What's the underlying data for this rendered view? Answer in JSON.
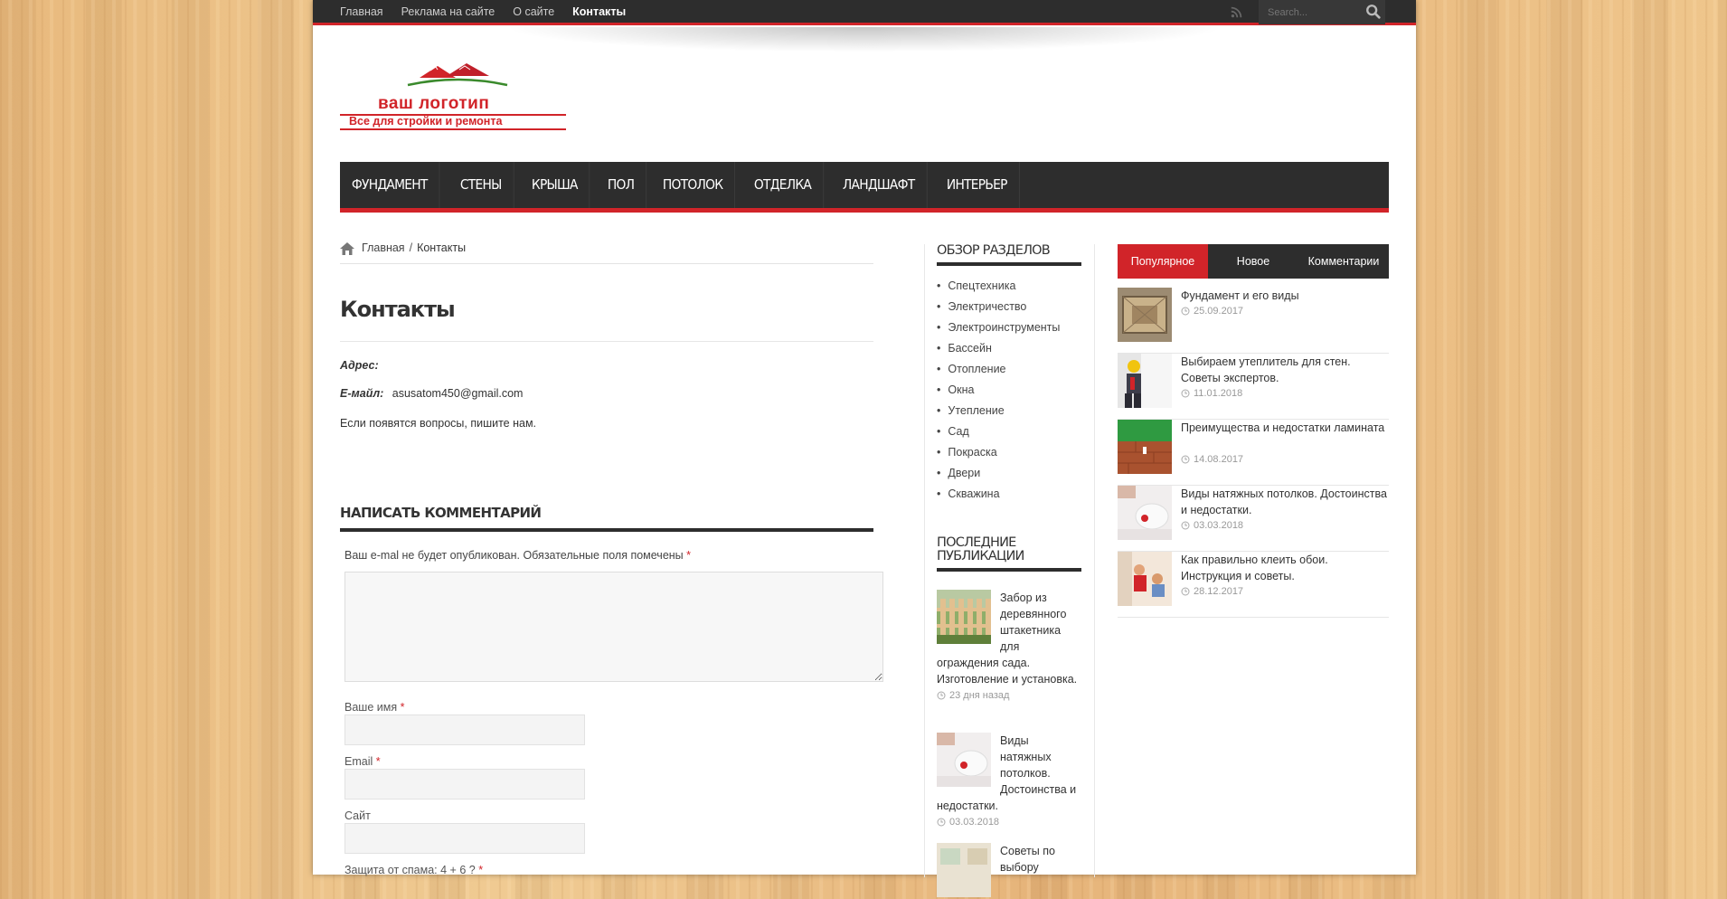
{
  "topbar": {
    "nav": [
      "Главная",
      "Реклама на сайте",
      "О сайте",
      "Контакты"
    ],
    "active_index": 3,
    "search_placeholder": "Search..."
  },
  "logo": {
    "title": "ваш логотип",
    "subtitle": "Все для стройки и ремонта"
  },
  "main_nav": [
    "ФУНДАМЕНТ",
    "СТЕНЫ",
    "КРЫША",
    "ПОЛ",
    "ПОТОЛОК",
    "ОТДЕЛКА",
    "ЛАНДШАФТ",
    "ИНТЕРЬЕР"
  ],
  "breadcrumb": {
    "home": "Главная",
    "separator": "/",
    "current": "Контакты"
  },
  "page": {
    "title": "Контакты",
    "address_label": "Адрес:",
    "email_label": "E-майл:",
    "email_value": "asusatom450@gmail.com",
    "note": "Если появятся вопросы, пишите нам."
  },
  "comment_form": {
    "title": "НАПИСАТЬ КОММЕНТАРИЙ",
    "note": "Ваш e-mal не будет опубликован. Обязательные поля помечены",
    "required_mark": "*",
    "name_label": "Ваше имя",
    "email_label": "Email",
    "site_label": "Сайт",
    "spam_label": "Защита от спама: 4 + 6 ?"
  },
  "sidebar": {
    "categories_title": "ОБЗОР РАЗДЕЛОВ",
    "categories": [
      "Спецтехника",
      "Электричество",
      "Электроинструменты",
      "Бассейн",
      "Отопление",
      "Окна",
      "Утепление",
      "Сад",
      "Покраска",
      "Двери",
      "Скважина"
    ],
    "recent_title_line1": "ПОСЛЕДНИЕ",
    "recent_title_line2": "ПУБЛИКАЦИИ",
    "recent": [
      {
        "title": "Забор из деревянного штакетника для ограждения сада. Изготовление и установка.",
        "date": "23 дня назад"
      },
      {
        "title": "Виды натяжных потолков. Достоинства и недостатки.",
        "date": "03.03.2018"
      },
      {
        "title": "Советы по выбору",
        "date": ""
      }
    ]
  },
  "tabs_widget": {
    "tabs": [
      "Популярное",
      "Новое",
      "Комментарии"
    ],
    "active_index": 0,
    "items": [
      {
        "title": "Фундамент и его виды",
        "date": "25.09.2017"
      },
      {
        "title": "Выбираем утеплитель для стен. Советы экспертов.",
        "date": "11.01.2018"
      },
      {
        "title": "Преимущества и недостатки ламината",
        "date": "14.08.2017"
      },
      {
        "title": "Виды натяжных потолков. Достоинства и недостатки.",
        "date": "03.03.2018"
      },
      {
        "title": "Как правильно клеить обои. Инструкция и советы.",
        "date": "28.12.2017"
      }
    ]
  },
  "colors": {
    "accent": "#d12429",
    "dark": "#2d2d2d"
  }
}
